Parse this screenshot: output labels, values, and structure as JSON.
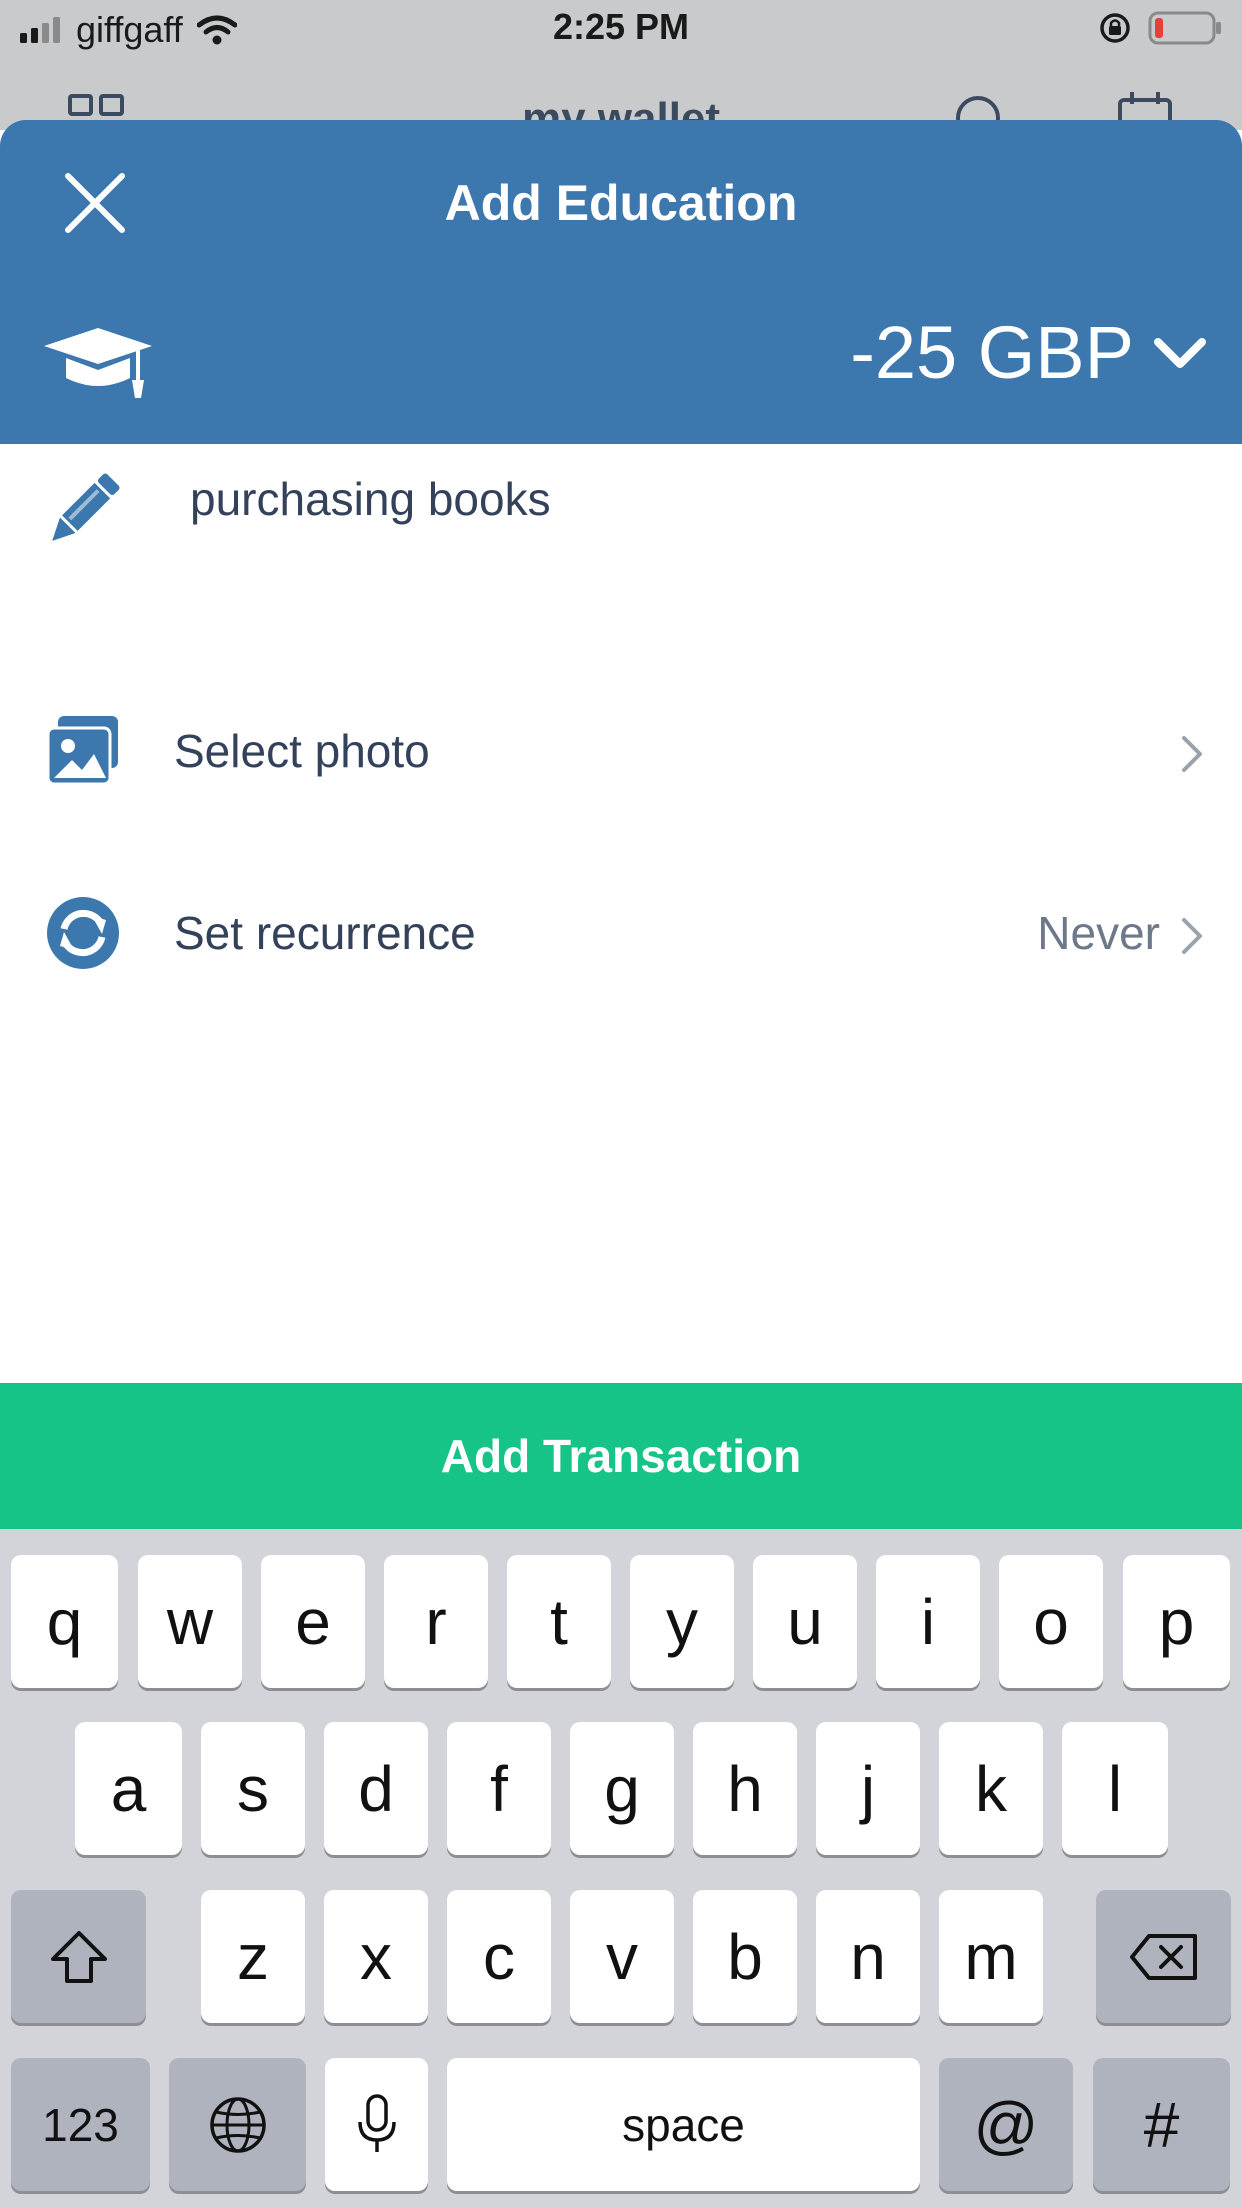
{
  "status_bar": {
    "carrier": "giffgaff",
    "time": "2:25 PM",
    "battery_color": "#e5413a"
  },
  "background_app": {
    "title": "my wallet"
  },
  "sheet": {
    "title": "Add Education",
    "category_icon": "graduation-cap-icon",
    "amount": "-25 GBP",
    "header_color": "#3c77ad"
  },
  "form": {
    "note": "purchasing books",
    "photo_label": "Select photo",
    "recurrence_label": "Set recurrence",
    "recurrence_value": "Never"
  },
  "actions": {
    "add_label": "Add Transaction",
    "add_color": "#16c488"
  },
  "keyboard": {
    "row1": [
      "q",
      "w",
      "e",
      "r",
      "t",
      "y",
      "u",
      "i",
      "o",
      "p"
    ],
    "row2": [
      "a",
      "s",
      "d",
      "f",
      "g",
      "h",
      "j",
      "k",
      "l"
    ],
    "row3": [
      "z",
      "x",
      "c",
      "v",
      "b",
      "n",
      "m"
    ],
    "numbers_label": "123",
    "space_label": "space",
    "at_label": "@",
    "hash_label": "#"
  }
}
